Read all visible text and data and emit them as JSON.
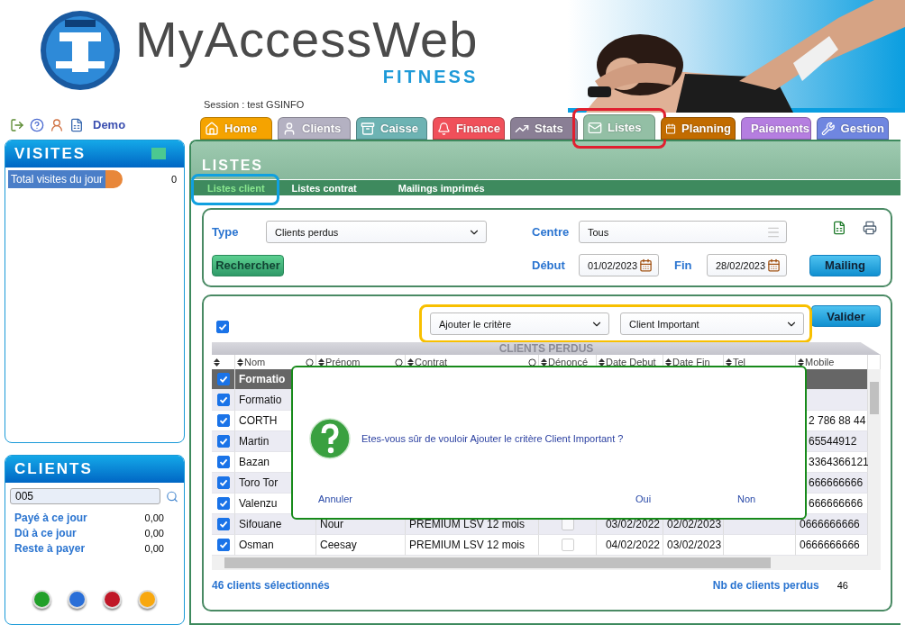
{
  "header": {
    "logo_text": "MyAccessWeb",
    "logo_subtitle": "FITNESS",
    "session": "Session : test GSINFO"
  },
  "user_bar": {
    "user": "Demo"
  },
  "visits": {
    "title": "VISITES",
    "rows": [
      {
        "label": "Total visites du jour",
        "value": "0"
      }
    ]
  },
  "clients": {
    "title": "CLIENTS",
    "search": {
      "value": "005"
    },
    "rows": [
      {
        "label": "Payé à ce jour",
        "value": "0,00"
      },
      {
        "label": "Dû à ce jour",
        "value": "0,00"
      },
      {
        "label": "Reste à payer",
        "value": "0,00"
      }
    ],
    "dots": [
      {
        "color": "#22a02a"
      },
      {
        "color": "#2a6fd8"
      },
      {
        "color": "#c01828"
      },
      {
        "color": "#f8a810"
      }
    ]
  },
  "tabs": [
    {
      "label": "Home",
      "color": "#f5a300",
      "selected": false,
      "highlighted": false
    },
    {
      "label": "Clients",
      "color": "#b4b1c2",
      "selected": false,
      "highlighted": false
    },
    {
      "label": "Caisse",
      "color": "#6db3b3",
      "selected": false,
      "highlighted": false
    },
    {
      "label": "Finance",
      "color": "#f0505a",
      "selected": false,
      "highlighted": false
    },
    {
      "label": "Stats",
      "color": "#8a7f95",
      "selected": false,
      "highlighted": false
    },
    {
      "label": "Listes",
      "color": "#93bfa5",
      "selected": true,
      "highlighted": true
    },
    {
      "label": "Planning",
      "color": "#c26c00",
      "selected": false,
      "highlighted": false
    },
    {
      "label": "Paiements",
      "color": "#b57ee0",
      "selected": false,
      "highlighted": false
    },
    {
      "label": "Gestion",
      "color": "#6f86e0",
      "selected": false,
      "highlighted": false
    }
  ],
  "section": {
    "title": "LISTES",
    "subtabs": [
      {
        "label": "Listes client",
        "selected": true,
        "highlighted": true
      },
      {
        "label": "Listes contrat",
        "selected": false,
        "highlighted": false
      },
      {
        "label": "Mailings imprimés",
        "selected": false,
        "highlighted": false
      }
    ]
  },
  "filters": {
    "type": {
      "label": "Type",
      "value": "Clients perdus"
    },
    "centre": {
      "label": "Centre",
      "value": "Tous"
    },
    "start": {
      "label": "Début",
      "value": "01/02/2023"
    },
    "end": {
      "label": "Fin",
      "value": "28/02/2023"
    },
    "search_button": "Rechercher",
    "mailing_button": "Mailing"
  },
  "criteria": {
    "select_all": {
      "checked": true
    },
    "highlighted": true,
    "criterion": "Ajouter le critère",
    "option": "Client Important",
    "submit": "Valider"
  },
  "table": {
    "title": "CLIENTS PERDUS",
    "columns": [
      {
        "label": "Nom",
        "filter": true
      },
      {
        "label": "Prénom",
        "filter": true
      },
      {
        "label": "Contrat",
        "filter": true
      },
      {
        "label": "Dénoncé",
        "filter": false
      },
      {
        "label": "Date Debut",
        "filter": false
      },
      {
        "label": "Date Fin",
        "filter": false
      },
      {
        "label": "Tel",
        "filter": false
      },
      {
        "label": "Mobile",
        "filter": false
      }
    ],
    "rows": [
      {
        "checked": true,
        "selected": true,
        "nom": "Formatio"
      },
      {
        "checked": true,
        "selected": false,
        "nom": "Formatio"
      },
      {
        "checked": true,
        "selected": false,
        "nom": "CORTH",
        "mobile": "2 786 88 44"
      },
      {
        "checked": true,
        "selected": false,
        "nom": "Martin",
        "mobile": "65544912"
      },
      {
        "checked": true,
        "selected": false,
        "nom": "Bazan",
        "mobile": "3364366121"
      },
      {
        "checked": true,
        "selected": false,
        "nom": "Toro Tor",
        "mobile": "666666666"
      },
      {
        "checked": true,
        "selected": false,
        "nom": "Valenzu",
        "mobile": "666666666"
      },
      {
        "checked": true,
        "selected": false,
        "nom": "Sifouane",
        "prenom": "Nour",
        "contrat": "PREMIUM LSV 12 mois",
        "denonce": false,
        "date_debut": "03/02/2022",
        "date_fin": "02/02/2023",
        "mobile": "0666666666"
      },
      {
        "checked": true,
        "selected": false,
        "nom": "Osman",
        "prenom": "Ceesay",
        "contrat": "PREMIUM LSV 12 mois",
        "denonce": false,
        "date_debut": "04/02/2022",
        "date_fin": "03/02/2023",
        "mobile": "0666666666"
      }
    ]
  },
  "dialog": {
    "message": "Etes-vous sûr de vouloir Ajouter le critère Client Important ?",
    "buttons": [
      "Annuler",
      "Oui",
      "Non"
    ]
  },
  "footer": {
    "selected_count": "46 clients sélectionnés",
    "total_label": "Nb de clients perdus",
    "total": "46"
  }
}
